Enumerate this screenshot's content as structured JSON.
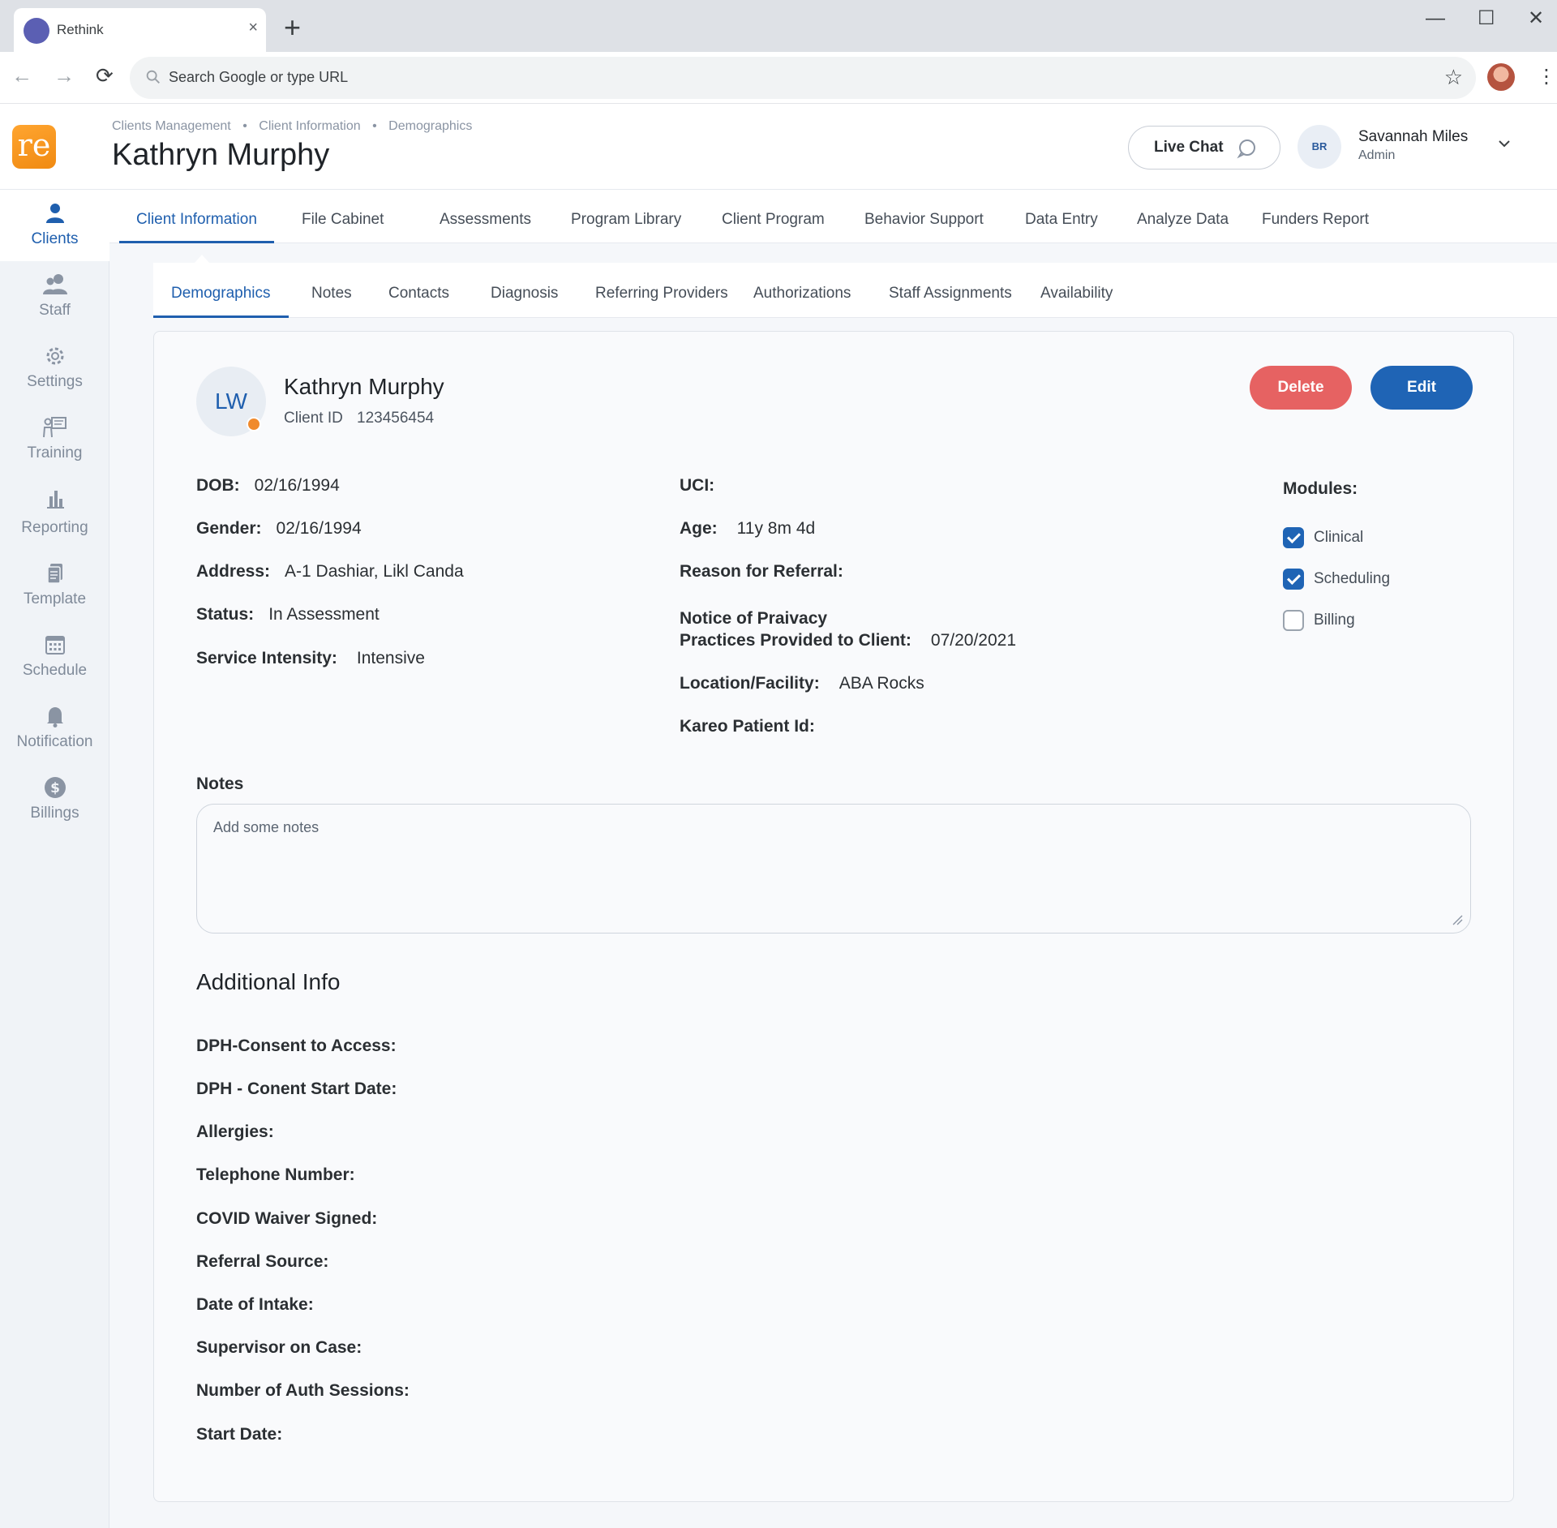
{
  "browser": {
    "tab_title": "Rethink",
    "tab_close": "×",
    "new_tab": "+",
    "omnibox_placeholder": "Search Google or type URL",
    "controls": {
      "minimize": "—",
      "maximize": "☐",
      "close": "✕"
    }
  },
  "header": {
    "logo_text": "re",
    "breadcrumb": [
      "Clients Management",
      "Client Information",
      "Demographics"
    ],
    "breadcrumb_sep": "•",
    "title": "Kathryn Murphy",
    "live_chat": "Live Chat",
    "user": {
      "initials": "BR",
      "name": "Savannah Miles",
      "role": "Admin"
    }
  },
  "sidebar": {
    "items": [
      {
        "label": "Clients",
        "icon": "person-icon",
        "active": true
      },
      {
        "label": "Staff",
        "icon": "people-icon"
      },
      {
        "label": "Settings",
        "icon": "gear-icon"
      },
      {
        "label": "Training",
        "icon": "presentation-icon"
      },
      {
        "label": "Reporting",
        "icon": "bar-chart-icon"
      },
      {
        "label": "Template",
        "icon": "document-icon"
      },
      {
        "label": "Schedule",
        "icon": "calendar-icon"
      },
      {
        "label": "Notification",
        "icon": "bell-icon"
      },
      {
        "label": "Billings",
        "icon": "dollar-icon"
      }
    ]
  },
  "main_tabs": [
    "Client Information",
    "File Cabinet",
    "Assessments",
    "Program Library",
    "Client Program",
    "Behavior Support",
    "Data Entry",
    "Analyze Data",
    "Funders Report"
  ],
  "sub_tabs": [
    "Demographics",
    "Notes",
    "Contacts",
    "Diagnosis",
    "Referring Providers",
    "Authorizations",
    "Staff Assignments",
    "Availability"
  ],
  "client": {
    "initials": "LW",
    "name": "Kathryn Murphy",
    "id_label": "Client ID",
    "id_value": "123456454",
    "delete_label": "Delete",
    "edit_label": "Edit"
  },
  "fields_left": [
    {
      "label": "DOB:",
      "value": "02/16/1994"
    },
    {
      "label": "Gender:",
      "value": "02/16/1994"
    },
    {
      "label": "Address:",
      "value": "A-1 Dashiar, Likl Canda"
    },
    {
      "label": "Status:",
      "value": "In Assessment"
    },
    {
      "label": "Service Intensity:",
      "value": "Intensive"
    }
  ],
  "fields_mid": {
    "uci": {
      "label": "UCI:",
      "value": ""
    },
    "age": {
      "label": "Age:",
      "value": "11y 8m 4d"
    },
    "referral": {
      "label": "Reason for Referral:",
      "value": ""
    },
    "notice_line1": "Notice of Praivacy",
    "notice_line2": "Practices Provided to Client:",
    "notice_value": "07/20/2021",
    "location": {
      "label": "Location/Facility:",
      "value": "ABA Rocks"
    },
    "kareo": {
      "label": "Kareo Patient Id:",
      "value": ""
    }
  },
  "modules": {
    "title": "Modules:",
    "items": [
      {
        "label": "Clinical",
        "checked": true
      },
      {
        "label": "Scheduling",
        "checked": true
      },
      {
        "label": "Billing",
        "checked": false
      }
    ]
  },
  "notes": {
    "label": "Notes",
    "placeholder": "Add some notes"
  },
  "additional": {
    "title": "Additional Info",
    "fields": [
      "DPH-Consent to Access:",
      "DPH - Conent Start Date:",
      "Allergies:",
      "Telephone Number:",
      "COVID Waiver Signed:",
      "Referral Source:",
      "Date of Intake:",
      "Supervisor on Case:",
      "Number of Auth Sessions:",
      "Start Date:"
    ]
  },
  "colors": {
    "primary": "#1f64b5",
    "danger": "#e66262",
    "status_dot": "#f08a2c",
    "logo": "#f59a1e"
  }
}
